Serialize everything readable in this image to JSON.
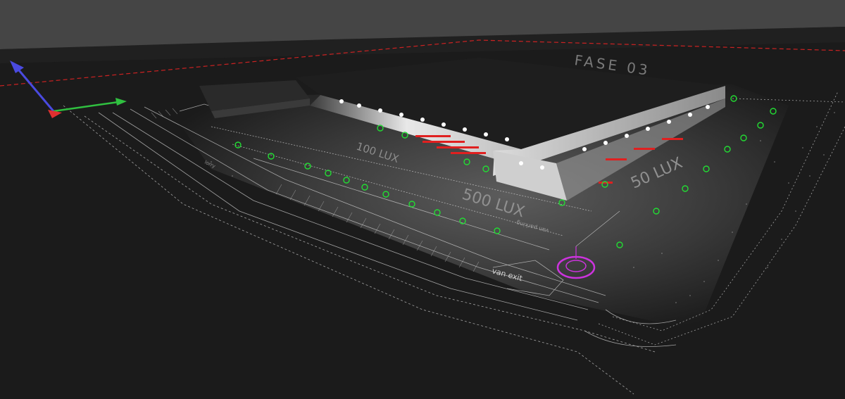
{
  "viewport": {
    "background": "#161616",
    "sky_color": "#454545",
    "ground_color": "#1b1b1b",
    "yard_lit_color": "#4a4a4a"
  },
  "building": {
    "name": "FASE 03",
    "roof_color": "#1e1e1e",
    "facade_color": "#cfcfcf"
  },
  "labels": {
    "lux_yard_left": "100 LUX",
    "lux_yard_center": "500 LUX",
    "lux_yard_right": "50 LUX",
    "road_exit": "van exit",
    "road_parking": "van parking",
    "road_side": "lorry"
  },
  "gizmo": {
    "x_axis_color": "#e03030",
    "y_axis_color": "#30c040",
    "z_axis_color": "#4a4ae0"
  },
  "markers": {
    "luminaire_color": "#22dd33",
    "loading_dock_color": "#e02020",
    "selection_color": "#cc33dd",
    "site_boundary_color": "#cc2222"
  }
}
